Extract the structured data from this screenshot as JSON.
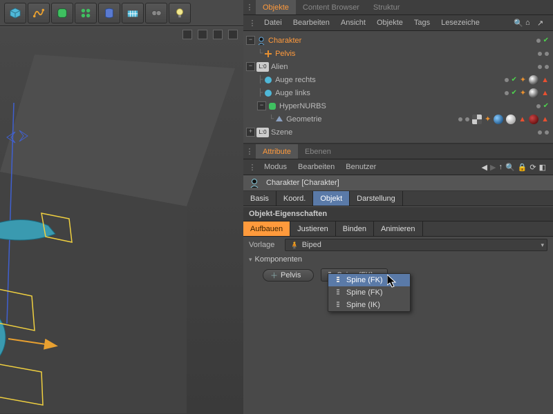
{
  "tabs": {
    "objects": "Objekte",
    "content": "Content Browser",
    "structure": "Struktur"
  },
  "menu": {
    "file": "Datei",
    "edit": "Bearbeiten",
    "view": "Ansicht",
    "objects": "Objekte",
    "tags": "Tags",
    "bookmarks": "Lesezeiche"
  },
  "tree": {
    "charakter": "Charakter",
    "pelvis": "Pelvis",
    "alien": "Alien",
    "auge_r": "Auge rechts",
    "auge_l": "Auge links",
    "hypernurbs": "HyperNURBS",
    "geometrie": "Geometrie",
    "szene": "Szene"
  },
  "attr_tabs": {
    "attribute": "Attribute",
    "ebenen": "Ebenen"
  },
  "attr_menu": {
    "modus": "Modus",
    "bearbeiten": "Bearbeiten",
    "benutzer": "Benutzer"
  },
  "header_title": "Charakter [Charakter]",
  "mode_tabs": {
    "basis": "Basis",
    "koord": "Koord.",
    "objekt": "Objekt",
    "darst": "Darstellung"
  },
  "section": "Objekt-Eigenschaften",
  "build_tabs": {
    "aufbauen": "Aufbauen",
    "justieren": "Justieren",
    "binden": "Binden",
    "animieren": "Animieren"
  },
  "vorlage_label": "Vorlage",
  "vorlage_value": "Biped",
  "komponenten": "Komponenten",
  "pelvis_chip": "Pelvis",
  "spine_selected": "Spine (FK)",
  "popup": {
    "fk": "Spine (FK)",
    "ik": "Spine (IK)"
  },
  "levels": {
    "l0": "L:0"
  }
}
